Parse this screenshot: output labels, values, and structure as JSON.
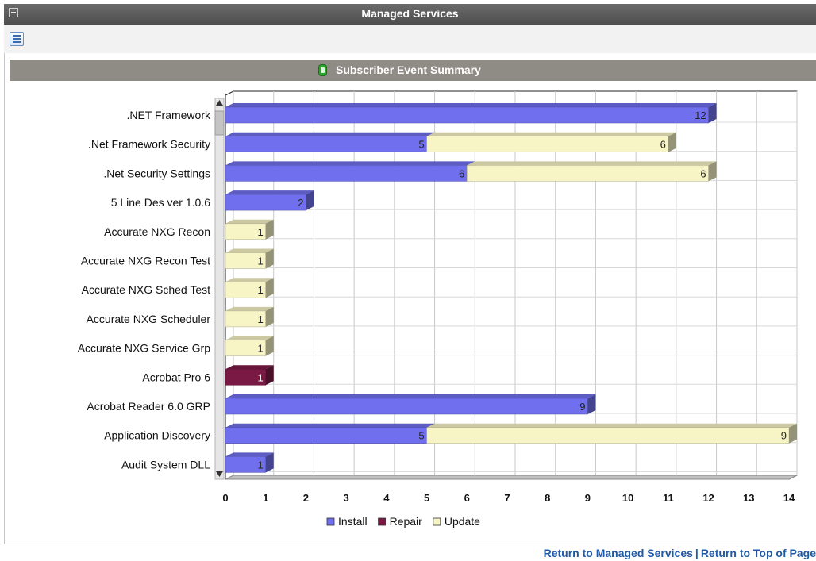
{
  "window": {
    "title": "Managed Services"
  },
  "section": {
    "title": "Subscriber Event Summary"
  },
  "footer": {
    "link_managed": "Return to Managed Services",
    "separator": "|",
    "link_top": "Return to Top of Page"
  },
  "colors": {
    "install": "#7070ee",
    "repair": "#7a1a44",
    "update": "#f7f4c6"
  },
  "chart_data": {
    "type": "bar",
    "orientation": "horizontal",
    "stacked": true,
    "categories": [
      ".NET Framework",
      ".Net Framework Security",
      ".Net Security Settings",
      "5 Line Des ver 1.0.6",
      "Accurate NXG Recon",
      "Accurate NXG Recon Test",
      "Accurate NXG Sched Test",
      "Accurate NXG Scheduler",
      "Accurate NXG Service Grp",
      "Acrobat Pro 6",
      "Acrobat Reader 6.0 GRP",
      "Application Discovery",
      "Audit System DLL"
    ],
    "series": [
      {
        "name": "Install",
        "color": "#7070ee",
        "values": [
          12,
          5,
          6,
          2,
          0,
          0,
          0,
          0,
          0,
          0,
          9,
          5,
          1
        ]
      },
      {
        "name": "Repair",
        "color": "#7a1a44",
        "values": [
          0,
          0,
          0,
          0,
          0,
          0,
          0,
          0,
          0,
          1,
          0,
          0,
          0
        ]
      },
      {
        "name": "Update",
        "color": "#f7f4c6",
        "values": [
          0,
          6,
          6,
          0,
          1,
          1,
          1,
          1,
          1,
          0,
          0,
          9,
          0
        ]
      }
    ],
    "x_ticks": [
      0,
      1,
      2,
      3,
      4,
      5,
      6,
      7,
      8,
      9,
      10,
      11,
      12,
      13,
      14
    ],
    "xlim": [
      0,
      14
    ],
    "grid": true,
    "legend": "bottom-center",
    "title": "",
    "xlabel": "",
    "ylabel": ""
  }
}
